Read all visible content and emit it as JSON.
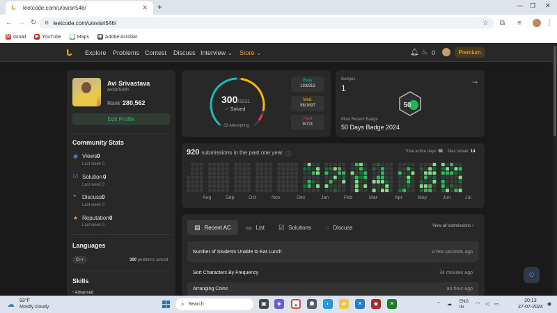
{
  "browser": {
    "tab_title": "leetcode.com/u/avisri546/",
    "url": "leetcode.com/u/avisri546/",
    "new_tab_label": "+",
    "bookmarks": [
      {
        "label": "Gmail",
        "color": "#d44638",
        "glyph": "M"
      },
      {
        "label": "YouTube",
        "color": "#e62117",
        "glyph": "▶"
      },
      {
        "label": "Maps",
        "color": "#34a853",
        "glyph": "⬤"
      },
      {
        "label": "Adobe Acrobat",
        "color": "#555555",
        "glyph": "◉"
      }
    ]
  },
  "nav": {
    "links": [
      "Explore",
      "Problems",
      "Contest",
      "Discuss",
      "Interview",
      "Store"
    ],
    "streak_count": "0",
    "premium_label": "Premium"
  },
  "profile": {
    "name": "Avi Srivastava",
    "username": "avisri546",
    "rank_label": "Rank",
    "rank_value": "280,562",
    "edit_label": "Edit Profile"
  },
  "community": {
    "title": "Community Stats",
    "items": [
      {
        "label": "Views",
        "value": "0",
        "sub": "Last week 0",
        "icon": "eye-icon",
        "color": "#3b8fe5"
      },
      {
        "label": "Solution",
        "value": "0",
        "sub": "Last week 0",
        "icon": "solution-icon",
        "color": "#3b8fe5"
      },
      {
        "label": "Discuss",
        "value": "0",
        "sub": "Last week 0",
        "icon": "discuss-icon",
        "color": "#2cbbbd"
      },
      {
        "label": "Reputation",
        "value": "0",
        "sub": "Last week 0",
        "icon": "star-icon",
        "color": "#f89f1b"
      }
    ]
  },
  "languages": {
    "title": "Languages",
    "chip": "C++",
    "solved_count": "300",
    "solved_suffix": "problems solved"
  },
  "skills": {
    "title": "Skills",
    "first_item": "Advanced"
  },
  "solved": {
    "solved": "300",
    "total": "/3231",
    "label": "Solved",
    "attempting": "33 Attempting",
    "easy_fraction": 0.1,
    "medium_fraction": 0.058,
    "hard_fraction": 0.012,
    "easy": {
      "label": "Easy",
      "value": "193/813",
      "color": "#1cbaba"
    },
    "medium": {
      "label": "Med.",
      "value": "98/1697",
      "color": "#ffb700"
    },
    "hard": {
      "label": "Hard",
      "value": "9/721",
      "color": "#f63737"
    }
  },
  "badges": {
    "label": "Badges",
    "count": "1",
    "recent_label": "Most Recent Badge",
    "recent_name": "50 Days Badge 2024",
    "badge_text": "50"
  },
  "submissions": {
    "count": "920",
    "text": "submissions in the past one year",
    "active_days_label": "Total active days:",
    "active_days": "81",
    "max_streak_label": "Max streak:",
    "max_streak": "14",
    "months": [
      "Aug",
      "Sep",
      "Oct",
      "Nov",
      "Dec",
      "Jan",
      "Feb",
      "Mar",
      "Apr",
      "May",
      "Jun",
      "Jul"
    ]
  },
  "recent": {
    "tabs": [
      "Recent AC",
      "List",
      "Solutions",
      "Discuss"
    ],
    "view_all": "View all submissions",
    "items": [
      {
        "title": "Number of Students Unable to Eat Lunch",
        "time": "a few seconds ago"
      },
      {
        "title": "Sort Characters By Frequency",
        "time": "34 minutes ago"
      },
      {
        "title": "Arranging Coins",
        "time": "an hour ago"
      }
    ]
  },
  "taskbar": {
    "temp": "93°F",
    "condition": "Mostly cloudy",
    "search": "Search",
    "lang_top": "ENG",
    "lang_bottom": "IN",
    "time": "20:13",
    "date": "27-07-2024"
  }
}
